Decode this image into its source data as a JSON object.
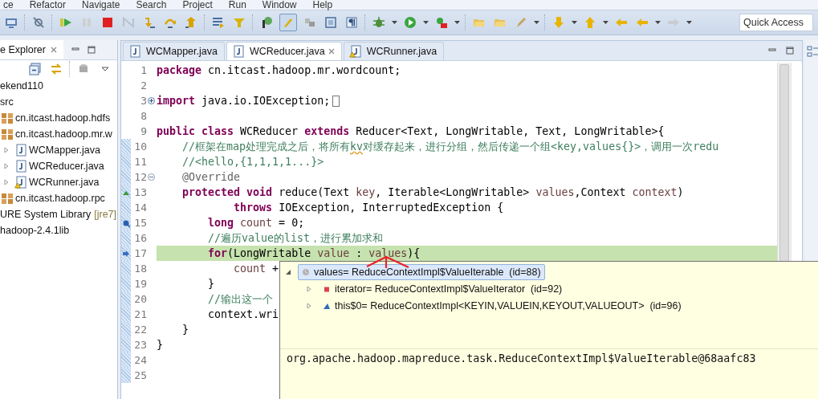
{
  "menu": [
    "ce",
    "Refactor",
    "Navigate",
    "Search",
    "Project",
    "Run",
    "Window",
    "Help"
  ],
  "quick_access": {
    "placeholder": "Quick Access"
  },
  "explorer": {
    "title": "e Explorer",
    "tree": [
      {
        "label": "ekend110",
        "children": [
          {
            "label": "src",
            "children": [
              {
                "label": "cn.itcast.hadoop.hdfs",
                "kind": "package"
              },
              {
                "label": "cn.itcast.hadoop.mr.w",
                "kind": "package",
                "children": [
                  {
                    "label": "WCMapper.java",
                    "kind": "java-file",
                    "expanded": false,
                    "warning": false
                  },
                  {
                    "label": "WCReducer.java",
                    "kind": "java-file",
                    "expanded": false,
                    "warning": false
                  },
                  {
                    "label": "WCRunner.java",
                    "kind": "java-file",
                    "expanded": false,
                    "warning": true
                  }
                ]
              },
              {
                "label": "cn.itcast.hadoop.rpc",
                "kind": "package"
              }
            ]
          },
          {
            "label": "URE System Library",
            "decoration": "[jre7]"
          },
          {
            "label": "hadoop-2.4.1lib"
          }
        ]
      }
    ]
  },
  "editor_tabs": [
    {
      "label": "WCMapper.java",
      "selected": false,
      "warning": false
    },
    {
      "label": "WCReducer.java",
      "selected": true,
      "warning": false
    },
    {
      "label": "WCRunner.java",
      "selected": false,
      "warning": true
    }
  ],
  "code_lines": [
    {
      "number": "1",
      "segments": [
        {
          "kind": "keyword",
          "text": "package "
        },
        {
          "kind": "plain",
          "text": "cn.itcast.hadoop.mr.wordcount;"
        }
      ]
    },
    {
      "number": "2"
    },
    {
      "number": "3",
      "fold_expanded": false,
      "segments": [
        {
          "kind": "keyword",
          "text": "import "
        },
        {
          "kind": "plain",
          "text": "java.io.IOException;"
        }
      ]
    },
    {
      "number": "8"
    },
    {
      "number": "9",
      "segments": [
        {
          "kind": "keyword",
          "text": "public class "
        },
        {
          "kind": "plain",
          "text": "WCReducer "
        },
        {
          "kind": "keyword",
          "text": "extends "
        },
        {
          "kind": "plain",
          "text": "Reducer<Text, LongWritable, Text, LongWritable>{"
        }
      ]
    },
    {
      "number": "10",
      "quick_diff": true,
      "segments": [
        {
          "kind": "comment",
          "text": "\t//框架在map处理完成之后，将所有"
        },
        {
          "kind": "comment",
          "text": "kv",
          "misspelled": true
        },
        {
          "kind": "comment",
          "text": "对缓存起来，进行分组，然后传递一个组<key,values{}>，调用一次redu"
        }
      ]
    },
    {
      "number": "11",
      "quick_diff": true,
      "segments": [
        {
          "kind": "comment",
          "text": "\t//<hello,{1,1,1,1...}>"
        }
      ]
    },
    {
      "number": "12",
      "quick_diff": true,
      "fold_expanded": true,
      "segments": [
        {
          "kind": "annotation",
          "text": "\t@Override"
        }
      ]
    },
    {
      "number": "13",
      "quick_diff": true,
      "override_marker": true,
      "segments": [
        {
          "kind": "keyword",
          "text": "\tprotected void "
        },
        {
          "kind": "plain",
          "text": "reduce(Text "
        },
        {
          "kind": "variable",
          "text": "key"
        },
        {
          "kind": "plain",
          "text": ", Iterable<LongWritable> "
        },
        {
          "kind": "variable",
          "text": "values"
        },
        {
          "kind": "plain",
          "text": ",Context "
        },
        {
          "kind": "variable",
          "text": "context"
        },
        {
          "kind": "plain",
          "text": ")"
        }
      ]
    },
    {
      "number": "14",
      "quick_diff": true,
      "segments": [
        {
          "kind": "keyword",
          "text": "\t\t\tthrows "
        },
        {
          "kind": "plain",
          "text": "IOException, InterruptedException {"
        }
      ]
    },
    {
      "number": "15",
      "quick_diff": true,
      "breakpoint": true,
      "segments": [
        {
          "kind": "keyword",
          "text": "\t\tlong "
        },
        {
          "kind": "variable",
          "text": "count"
        },
        {
          "kind": "plain",
          "text": " = 0;"
        }
      ]
    },
    {
      "number": "16",
      "quick_diff": true,
      "segments": [
        {
          "kind": "comment",
          "text": "\t\t//遍历value的list，进行累加求和"
        }
      ]
    },
    {
      "number": "17",
      "quick_diff": true,
      "instruction_pointer": true,
      "highlighted": true,
      "segments": [
        {
          "kind": "keyword",
          "text": "\t\tfor"
        },
        {
          "kind": "plain",
          "text": "(LongWritable "
        },
        {
          "kind": "variable",
          "text": "value"
        },
        {
          "kind": "plain",
          "text": " : "
        },
        {
          "kind": "variable",
          "text": "values"
        },
        {
          "kind": "plain",
          "text": "){"
        }
      ]
    },
    {
      "number": "18",
      "quick_diff": true,
      "segments": [
        {
          "kind": "variable",
          "text": "\t\t\tcount"
        },
        {
          "kind": "plain",
          "text": " +"
        }
      ]
    },
    {
      "number": "19",
      "quick_diff": true,
      "segments": [
        {
          "kind": "plain",
          "text": "\t\t}"
        }
      ]
    },
    {
      "number": "20",
      "quick_diff": true,
      "segments": [
        {
          "kind": "comment",
          "text": "\t\t//输出这一个"
        }
      ]
    },
    {
      "number": "21",
      "quick_diff": true,
      "segments": [
        {
          "kind": "plain",
          "text": "\t\tcontext.wri"
        }
      ]
    },
    {
      "number": "22",
      "quick_diff": true,
      "segments": [
        {
          "kind": "plain",
          "text": "\t}"
        }
      ]
    },
    {
      "number": "23",
      "quick_diff": true,
      "segments": [
        {
          "kind": "plain",
          "text": "}"
        }
      ]
    },
    {
      "number": "24",
      "quick_diff": true
    },
    {
      "number": "25",
      "quick_diff": true
    }
  ],
  "variables_popup": {
    "tree": [
      {
        "text": "values= ReduceContextImpl$ValueIterable  (id=88)",
        "kind": "local",
        "expanded": true,
        "selected": true,
        "children": [
          {
            "text": "iterator= ReduceContextImpl$ValueIterator  (id=92)",
            "kind": "private-field",
            "expanded": false,
            "selected": false
          },
          {
            "text": "this$0= ReduceContextImpl<KEYIN,VALUEIN,KEYOUT,VALUEOUT>  (id=96)",
            "kind": "final-field",
            "expanded": false,
            "selected": false
          }
        ]
      }
    ],
    "detail": "org.apache.hadoop.mapreduce.task.ReduceContextImpl$ValueIterable@68aafc83"
  }
}
